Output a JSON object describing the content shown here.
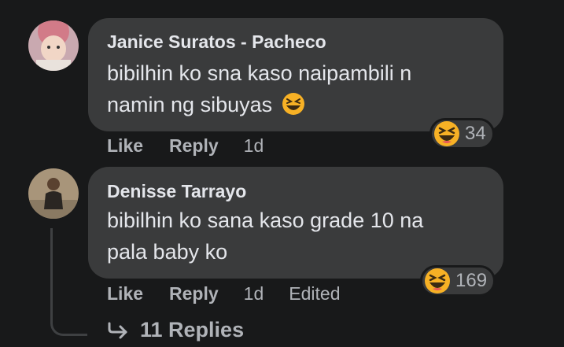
{
  "comments": [
    {
      "author": "Janice Suratos - Pacheco",
      "text_line1": "bibilhin ko sna kaso naipambili n",
      "text_line2": "namin ng sibuyas",
      "like_label": "Like",
      "reply_label": "Reply",
      "time": "1d",
      "reaction_icon": "laughing-emoji-icon",
      "reaction_count": "34"
    },
    {
      "author": "Denisse Tarrayo",
      "text_line1": "bibilhin ko sana kaso grade 10 na",
      "text_line2": "pala baby ko",
      "like_label": "Like",
      "reply_label": "Reply",
      "time": "1d",
      "edited_label": "Edited",
      "reaction_icon": "laughing-emoji-icon",
      "reaction_count": "169"
    }
  ],
  "replies_link": "11 Replies",
  "colors": {
    "background": "#18191a",
    "bubble": "#3a3b3c",
    "primary_text": "#e4e6eb",
    "secondary_text": "#b0b3b8",
    "emoji": "#f7b125"
  }
}
